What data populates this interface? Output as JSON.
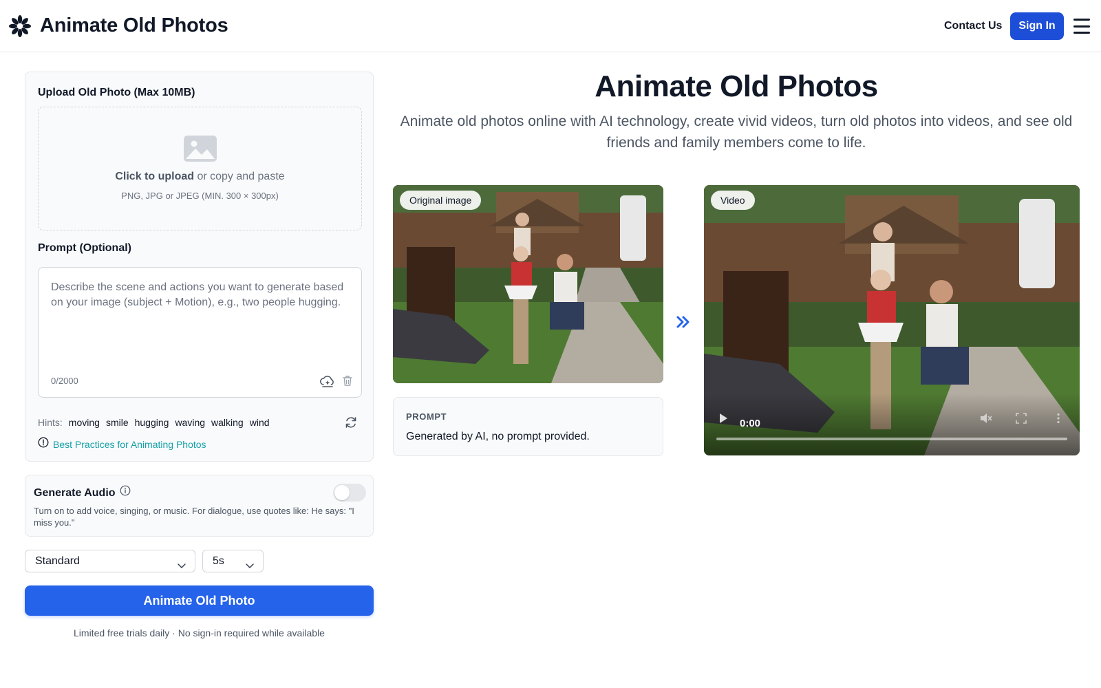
{
  "header": {
    "brand": "Animate Old Photos",
    "contact": "Contact Us",
    "sign_in": "Sign In"
  },
  "upload": {
    "label": "Upload Old Photo (Max 10MB)",
    "click_text": "Click to upload",
    "or_text": " or copy and paste",
    "formats": "PNG, JPG or JPEG (MIN. 300 × 300px)"
  },
  "prompt": {
    "label": "Prompt (Optional)",
    "placeholder": "Describe the scene and actions you want to generate based on your image (subject + Motion), e.g., two people hugging.",
    "value": "",
    "counter": "0/2000"
  },
  "hints": {
    "label": "Hints:",
    "items": [
      "moving",
      "smile",
      "hugging",
      "waving",
      "walking",
      "wind"
    ]
  },
  "best_practices": "Best Practices for Animating Photos",
  "audio": {
    "title": "Generate Audio",
    "description": "Turn on to add voice, singing, or music. For dialogue, use quotes like: He says: \"I miss you.\"",
    "enabled": false
  },
  "quality_select": {
    "value": "Standard"
  },
  "duration_select": {
    "value": "5s"
  },
  "animate_button": "Animate Old Photo",
  "note": "Limited free trials daily · No sign-in required while available",
  "hero": {
    "title": "Animate Old Photos",
    "subtitle": "Animate old photos online with AI technology, create vivid videos, turn old photos into videos, and see old friends and family members come to life."
  },
  "example": {
    "original_label": "Original image",
    "video_label": "Video",
    "prompt_label": "PROMPT",
    "prompt_text": "Generated by AI, no prompt provided.",
    "video_time": "0:00"
  },
  "colors": {
    "primary": "#2563eb",
    "sign_in": "#1d4ed8",
    "link": "#14a0a8"
  }
}
